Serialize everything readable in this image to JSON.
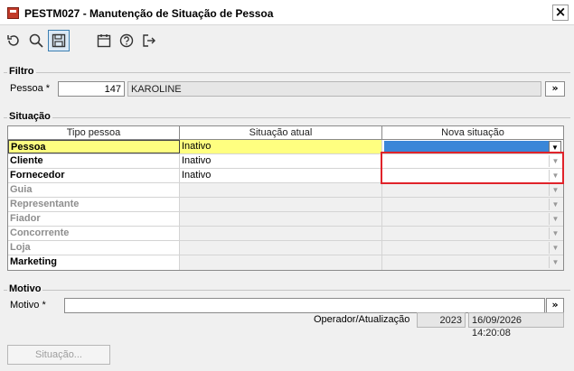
{
  "window": {
    "title": "PESTM027 - Manutenção de Situação de Pessoa",
    "close": "×"
  },
  "toolbar": {
    "icons": [
      "undo-icon",
      "search-icon",
      "save-icon",
      "calendar-icon",
      "help-icon",
      "exit-icon"
    ]
  },
  "filtro": {
    "legend": "Filtro",
    "pessoa_label": "Pessoa *",
    "pessoa_code": "147",
    "pessoa_name": "KAROLINE",
    "lookup_label": "»"
  },
  "situacao": {
    "legend": "Situação",
    "columns": [
      "Tipo pessoa",
      "Situação atual",
      "Nova situação"
    ],
    "rows": [
      {
        "tipo": "Pessoa",
        "atual": "Inativo",
        "nova": ""
      },
      {
        "tipo": "Cliente",
        "atual": "Inativo",
        "nova": ""
      },
      {
        "tipo": "Fornecedor",
        "atual": "Inativo",
        "nova": ""
      },
      {
        "tipo": "Guia",
        "atual": "",
        "nova": ""
      },
      {
        "tipo": "Representante",
        "atual": "",
        "nova": ""
      },
      {
        "tipo": "Fiador",
        "atual": "",
        "nova": ""
      },
      {
        "tipo": "Concorrente",
        "atual": "",
        "nova": ""
      },
      {
        "tipo": "Loja",
        "atual": "",
        "nova": ""
      },
      {
        "tipo": "Marketing",
        "atual": "",
        "nova": ""
      }
    ]
  },
  "motivo": {
    "legend": "Motivo",
    "motivo_label": "Motivo *",
    "motivo_value": "",
    "lookup_label": "»",
    "operador_label": "Operador/Atualização",
    "operador_code": "2023",
    "atualizacao": "16/09/2026 14:20:08"
  },
  "footer": {
    "situacao_button": "Situação..."
  },
  "colors": {
    "highlight": "#e0232a",
    "selected_row": "#ffff80",
    "dropdown_selected": "#3a86d8"
  }
}
